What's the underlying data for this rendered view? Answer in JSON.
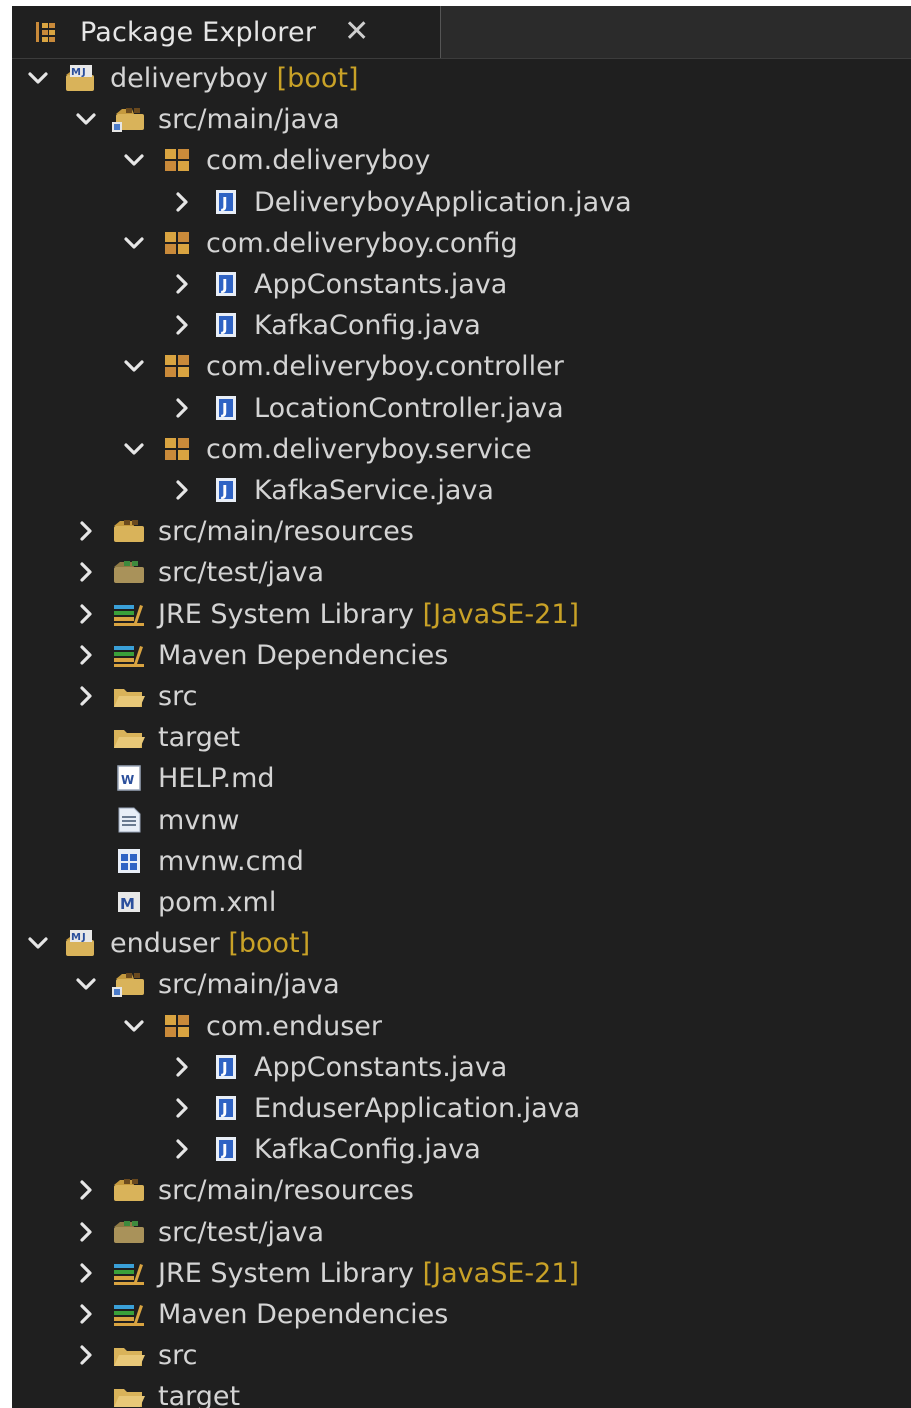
{
  "view": {
    "tab_label": "Package Explorer",
    "tab_icon": "package-explorer-icon",
    "close_icon": "close-icon"
  },
  "colors": {
    "panel_bg": "#1f1f1f",
    "text": "#d4d4d4",
    "decoration": "#c9a227"
  },
  "tree": [
    {
      "depth": 0,
      "expand": "open",
      "icon": "maven-project-icon",
      "label": "deliveryboy",
      "deco": " [boot]"
    },
    {
      "depth": 1,
      "expand": "open",
      "icon": "source-folder-icon",
      "label": "src/main/java",
      "deco": ""
    },
    {
      "depth": 2,
      "expand": "open",
      "icon": "package-icon",
      "label": "com.deliveryboy",
      "deco": ""
    },
    {
      "depth": 3,
      "expand": "closed",
      "icon": "java-file-icon",
      "label": "DeliveryboyApplication.java",
      "deco": ""
    },
    {
      "depth": 2,
      "expand": "open",
      "icon": "package-icon",
      "label": "com.deliveryboy.config",
      "deco": ""
    },
    {
      "depth": 3,
      "expand": "closed",
      "icon": "java-file-icon",
      "label": "AppConstants.java",
      "deco": ""
    },
    {
      "depth": 3,
      "expand": "closed",
      "icon": "java-file-icon",
      "label": "KafkaConfig.java",
      "deco": ""
    },
    {
      "depth": 2,
      "expand": "open",
      "icon": "package-icon",
      "label": "com.deliveryboy.controller",
      "deco": ""
    },
    {
      "depth": 3,
      "expand": "closed",
      "icon": "java-file-icon",
      "label": "LocationController.java",
      "deco": ""
    },
    {
      "depth": 2,
      "expand": "open",
      "icon": "package-icon",
      "label": "com.deliveryboy.service",
      "deco": ""
    },
    {
      "depth": 3,
      "expand": "closed",
      "icon": "java-file-icon",
      "label": "KafkaService.java",
      "deco": ""
    },
    {
      "depth": 1,
      "expand": "closed",
      "icon": "resource-folder-icon",
      "label": "src/main/resources",
      "deco": ""
    },
    {
      "depth": 1,
      "expand": "closed",
      "icon": "test-source-folder-icon",
      "label": "src/test/java",
      "deco": ""
    },
    {
      "depth": 1,
      "expand": "closed",
      "icon": "library-icon",
      "label": "JRE System Library",
      "deco": " [JavaSE-21]"
    },
    {
      "depth": 1,
      "expand": "closed",
      "icon": "library-icon",
      "label": "Maven Dependencies",
      "deco": ""
    },
    {
      "depth": 1,
      "expand": "closed",
      "icon": "folder-icon",
      "label": "src",
      "deco": ""
    },
    {
      "depth": 1,
      "expand": "none",
      "icon": "folder-icon",
      "label": "target",
      "deco": ""
    },
    {
      "depth": 1,
      "expand": "none",
      "icon": "markdown-file-icon",
      "label": "HELP.md",
      "deco": ""
    },
    {
      "depth": 1,
      "expand": "none",
      "icon": "text-file-icon",
      "label": "mvnw",
      "deco": ""
    },
    {
      "depth": 1,
      "expand": "none",
      "icon": "cmd-file-icon",
      "label": "mvnw.cmd",
      "deco": ""
    },
    {
      "depth": 1,
      "expand": "none",
      "icon": "pom-file-icon",
      "label": "pom.xml",
      "deco": ""
    },
    {
      "depth": 0,
      "expand": "open",
      "icon": "maven-project-icon",
      "label": "enduser",
      "deco": " [boot]"
    },
    {
      "depth": 1,
      "expand": "open",
      "icon": "source-folder-icon",
      "label": "src/main/java",
      "deco": ""
    },
    {
      "depth": 2,
      "expand": "open",
      "icon": "package-icon",
      "label": "com.enduser",
      "deco": ""
    },
    {
      "depth": 3,
      "expand": "closed",
      "icon": "java-file-icon",
      "label": "AppConstants.java",
      "deco": ""
    },
    {
      "depth": 3,
      "expand": "closed",
      "icon": "java-file-icon",
      "label": "EnduserApplication.java",
      "deco": ""
    },
    {
      "depth": 3,
      "expand": "closed",
      "icon": "java-file-icon",
      "label": "KafkaConfig.java",
      "deco": ""
    },
    {
      "depth": 1,
      "expand": "closed",
      "icon": "resource-folder-icon",
      "label": "src/main/resources",
      "deco": ""
    },
    {
      "depth": 1,
      "expand": "closed",
      "icon": "test-source-folder-icon",
      "label": "src/test/java",
      "deco": ""
    },
    {
      "depth": 1,
      "expand": "closed",
      "icon": "library-icon",
      "label": "JRE System Library",
      "deco": " [JavaSE-21]"
    },
    {
      "depth": 1,
      "expand": "closed",
      "icon": "library-icon",
      "label": "Maven Dependencies",
      "deco": ""
    },
    {
      "depth": 1,
      "expand": "closed",
      "icon": "folder-icon",
      "label": "src",
      "deco": ""
    },
    {
      "depth": 1,
      "expand": "none",
      "icon": "folder-icon",
      "label": "target",
      "deco": ""
    }
  ]
}
